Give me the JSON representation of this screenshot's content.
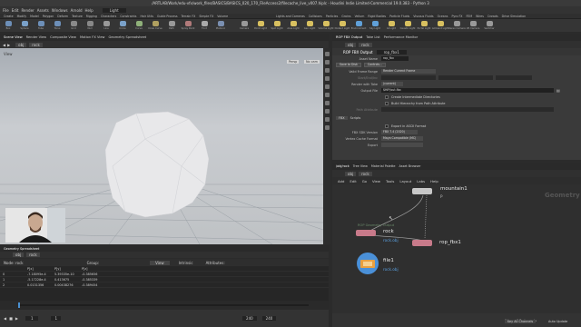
{
  "window": {
    "title": "/ARTLAB/Work/edu-vfx/work_files/BASICS/BASICS_020_170_FileAccess2/filecache_live_v007.hiplc - Houdini Indie Limited-Commercial 19.0.383 - Python 3"
  },
  "menu": [
    "File",
    "Edit",
    "Render",
    "Assets",
    "Windows",
    "Arnold",
    "Help"
  ],
  "desktop": "Light",
  "shelf_tabs_left": [
    "Create",
    "Modify",
    "Model",
    "Polygon",
    "Deform",
    "Texture",
    "Rigging",
    "Characters",
    "Constraints",
    "Hair Utils",
    "Guide Process",
    "Terrain FX",
    "Simple FX",
    "Volume"
  ],
  "shelf_tabs_right": [
    "Lights and Cameras",
    "Collisions",
    "Particles",
    "Grains",
    "Vellum",
    "Rigid Bodies",
    "Particle Fluids",
    "Viscous Fluids",
    "Oceans",
    "Pyro FX",
    "FEM",
    "Wires",
    "Crowds",
    "Drive Simulation"
  ],
  "shelf_tools": [
    {
      "label": "Box",
      "color": "#6d8fb8"
    },
    {
      "label": "Sphere",
      "color": "#7aa1c9"
    },
    {
      "label": "Tube",
      "color": "#6d8fb8"
    },
    {
      "label": "Torus",
      "color": "#6d8fb8"
    },
    {
      "label": "Grid",
      "color": "#8a8a8a"
    },
    {
      "label": "Null",
      "color": "#888"
    },
    {
      "label": "Line",
      "color": "#999"
    },
    {
      "label": "Circle",
      "color": "#7aa1c9"
    },
    {
      "label": "Curve",
      "color": "#8fb07a"
    },
    {
      "label": "Draw Curve",
      "color": "#b0a060"
    },
    {
      "label": "Path",
      "color": "#999"
    },
    {
      "label": "Spray Paint",
      "color": "#b07a7a"
    },
    {
      "label": "Font",
      "color": "#aaa"
    },
    {
      "label": "Platonic",
      "color": "#7a8fb0"
    },
    {
      "label": "Camera",
      "color": "#999"
    },
    {
      "label": "Point Light",
      "color": "#d8c060"
    },
    {
      "label": "Spot Light",
      "color": "#d8c060"
    },
    {
      "label": "Area Light",
      "color": "#d8c060"
    },
    {
      "label": "Geo Light",
      "color": "#d8c060"
    },
    {
      "label": "Volume Light",
      "color": "#d8c060"
    },
    {
      "label": "Distant Light",
      "color": "#d8c060"
    },
    {
      "label": "Environment",
      "color": "#60a0d8"
    },
    {
      "label": "Sky Light",
      "color": "#60a0d8"
    },
    {
      "label": "GI Light",
      "color": "#d8c060"
    },
    {
      "label": "Caustic Light",
      "color": "#d8c060"
    },
    {
      "label": "Portal Light",
      "color": "#d8c060"
    },
    {
      "label": "Ambient Light",
      "color": "#d8c060"
    },
    {
      "label": "Stereo Camera",
      "color": "#999"
    },
    {
      "label": "VR Camera",
      "color": "#999"
    },
    {
      "label": "Switcher",
      "color": "#999"
    }
  ],
  "left_tabs": [
    "Scene View",
    "Render View",
    "Composite View",
    "Motion FX View",
    "Geometry Spreadsheet"
  ],
  "left_path": "obj",
  "left_path_node": "rock",
  "viewport": {
    "label": "View",
    "perspective": "Persp",
    "camera": "No cam"
  },
  "spreadsheet": {
    "tabs": [
      "Geometry Spreadsheet"
    ],
    "path_obj": "obj",
    "path_node": "rock",
    "node_label": "Node: rock",
    "group_label": "Group:",
    "view_label": "View",
    "intrinsic_label": "Intrinsic",
    "attributes_label": "Attributes:",
    "columns": [
      "",
      "P[x]",
      "P[y]",
      "P[z]"
    ],
    "rows": [
      [
        "0",
        "-7.18095e-4",
        "5.39335e-10",
        "-0.385656"
      ],
      [
        "1",
        "-5.17228e-4",
        "0.413675",
        "-0.385339"
      ],
      [
        "2",
        "0.0131356",
        "0.00438276",
        "-0.389454"
      ]
    ]
  },
  "timeline": {
    "frame": "1",
    "start": "1",
    "end": "240",
    "end2": "240",
    "keys_label": "0 keys, 0/0 channels",
    "keychannels_label": "Key All Channels"
  },
  "right_tabs": [
    "ROP FBX Output",
    "Take List",
    "Performance Monitor"
  ],
  "right_path_obj": "obj",
  "right_path_node": "rock",
  "params": {
    "header_type": "ROP FBX Output",
    "header_name": "rop_fbx1",
    "asset_name_label": "Asset Name",
    "asset_name_value": "rop_fbx",
    "save_to_disk": "Save to Disk",
    "controls": "Controls...",
    "valid_frame_range_label": "Valid Frame Range",
    "valid_frame_range_value": "Render Current Frame",
    "start_end_label": "Start/End/Inc",
    "render_with_take_label": "Render with Take",
    "render_with_take_value": "(current)",
    "output_file_label": "Output File",
    "output_file_value": "$HIP/out.fbx",
    "create_dirs": "Create Intermediate Directories",
    "build_hierarchy": "Build Hierarchy from Path Attribute",
    "path_attr_label": "Path Attribute",
    "path_attr_value": "",
    "sub_tabs": [
      "FBX",
      "Scripts"
    ],
    "export_ascii": "Export in ASCII Format",
    "fbx_sdk_label": "FBX SDK Version",
    "fbx_sdk_value": "FBX 7.4 (2020)",
    "vertex_cache_label": "Vertex Cache Format",
    "vertex_cache_value": "Maya Compatible (MC)",
    "export_label": "Export",
    "export_value": ""
  },
  "network": {
    "tabs": [
      "/obj/rock",
      "Tree View",
      "Material Palette",
      "Asset Browser"
    ],
    "path_obj": "obj",
    "path_node": "rock",
    "menu": [
      "Add",
      "Edit",
      "Go",
      "View",
      "Tools",
      "Layout",
      "Labs",
      "Help"
    ],
    "context_label": "Geometry",
    "nodes": {
      "mountains_label": "mountain1",
      "mountains_sub": "P",
      "rock_label": "rock",
      "rock_sub": "rock.obj",
      "rop_label": "rop_fbx1",
      "rop_ghost": "ROP Geometry Output",
      "file_label": "file1",
      "file_sub": "rock.obj"
    }
  },
  "status": {
    "auto_update": "Auto Update"
  }
}
